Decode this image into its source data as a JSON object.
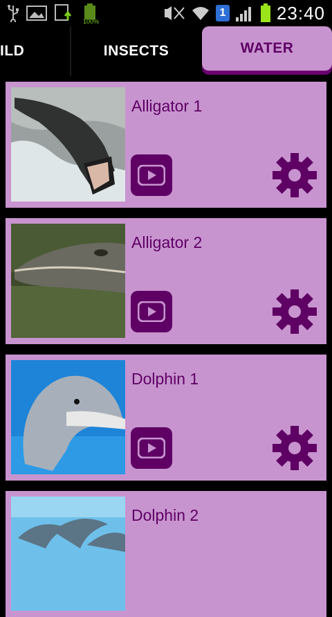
{
  "status_bar": {
    "time": "23:40",
    "battery_small_label": "100%",
    "sim_badge": "1"
  },
  "tabs": [
    {
      "label": "ILD"
    },
    {
      "label": "INSECTS"
    },
    {
      "label": "WATER"
    }
  ],
  "cards": [
    {
      "title": "Alligator 1",
      "image": "alligator-mouth-open-photo"
    },
    {
      "title": "Alligator 2",
      "image": "alligator-head-photo"
    },
    {
      "title": "Dolphin 1",
      "image": "dolphin-smiling-photo"
    },
    {
      "title": "Dolphin 2",
      "image": "dolphins-jumping-photo"
    }
  ],
  "colors": {
    "card_bg": "#c894cf",
    "accent": "#5e0064",
    "tab_active_bg": "#c894cf"
  }
}
